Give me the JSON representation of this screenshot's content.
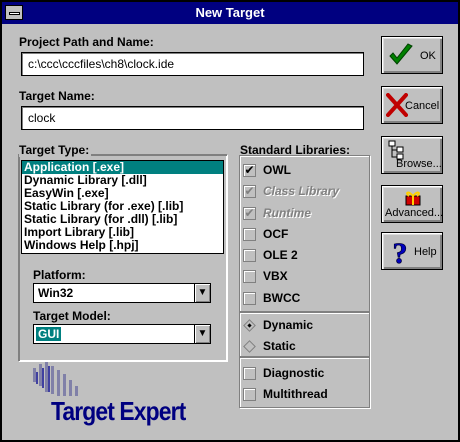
{
  "window": {
    "title": "New Target"
  },
  "project_path": {
    "label": "Project Path and Name:",
    "value": "c:\\ccc\\cccfiles\\ch8\\clock.ide"
  },
  "target_name": {
    "label": "Target Name:",
    "value": "clock"
  },
  "target_type": {
    "label": "Target Type:",
    "items": [
      "Application [.exe]",
      "Dynamic Library [.dll]",
      "EasyWin [.exe]",
      "Static Library (for .exe) [.lib]",
      "Static Library (for .dll) [.lib]",
      "Import Library [.lib]",
      "Windows Help [.hpj]"
    ],
    "selected_index": 0
  },
  "platform": {
    "label": "Platform:",
    "value": "Win32"
  },
  "target_model": {
    "label": "Target Model:",
    "value": "GUI"
  },
  "standard_libraries": {
    "label": "Standard Libraries:",
    "checkboxes": [
      {
        "label": "OWL",
        "checked": true,
        "enabled": true
      },
      {
        "label": "Class Library",
        "checked": true,
        "enabled": false
      },
      {
        "label": "Runtime",
        "checked": true,
        "enabled": false
      },
      {
        "label": "OCF",
        "checked": false,
        "enabled": true
      },
      {
        "label": "OLE 2",
        "checked": false,
        "enabled": true
      },
      {
        "label": "VBX",
        "checked": false,
        "enabled": true
      },
      {
        "label": "BWCC",
        "checked": false,
        "enabled": true
      }
    ],
    "linking": [
      {
        "label": "Dynamic",
        "selected": true
      },
      {
        "label": "Static",
        "selected": false
      }
    ],
    "options": [
      {
        "label": "Diagnostic",
        "checked": false
      },
      {
        "label": "Multithread",
        "checked": false
      }
    ]
  },
  "buttons": {
    "ok": "OK",
    "cancel": "Cancel",
    "browse": "Browse...",
    "advanced": "Advanced...",
    "help": "Help"
  },
  "branding": {
    "text": "Target Expert"
  },
  "colors": {
    "title_bar": "#000080",
    "selection": "#008080",
    "ok_check": "#008000",
    "cancel_x": "#c00000",
    "help_q": "#0000c0"
  },
  "icons": [
    "checkmark-icon",
    "x-icon",
    "browse-tree-icon",
    "advanced-gift-icon",
    "question-mark-icon",
    "dropdown-arrow-icon"
  ]
}
